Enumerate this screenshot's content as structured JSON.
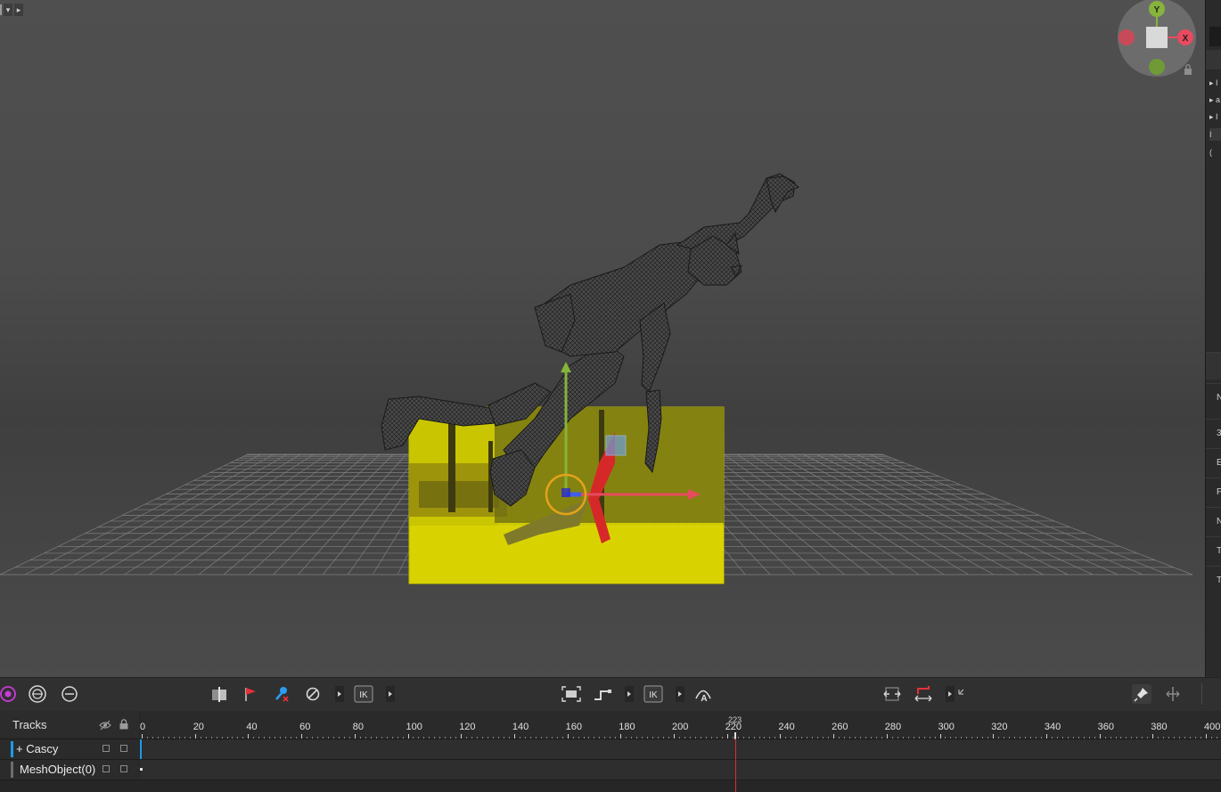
{
  "viewport": {
    "gizmo": {
      "axis_y": "Y",
      "axis_x": "X",
      "lock_icon": "lock-icon"
    },
    "colors": {
      "background_top": "#4f4f4f",
      "grid_line": "#8a8a8a",
      "video_plane_tint": "#d8d400",
      "axis_x": "#e84a5f",
      "axis_y": "#86b33c",
      "rotate_ring": "#e3a21a"
    }
  },
  "right_panel": {
    "partial_items": [
      "▸ I",
      "▸ a",
      "▸ I",
      "I",
      "("
    ],
    "partial_fields": [
      "N",
      "3",
      "E",
      "F",
      "N",
      "T",
      "T"
    ]
  },
  "toolbar": {
    "ik_label_1": "IK",
    "ik_label_2": "IK",
    "auto_label": "A",
    "icons": [
      "pose-target-icon",
      "orbit-icon",
      "rotate-view-icon",
      "split-keyframe-icon",
      "flag-marker-icon",
      "key-remove-icon",
      "disable-icon",
      "ik-toggle-icon",
      "frame-selection-icon",
      "step-curve-icon",
      "ik-mode-icon",
      "auto-key-icon",
      "fit-range-icon",
      "mirror-curve-icon",
      "pin-icon",
      "move-keys-icon"
    ]
  },
  "timeline": {
    "tracks_title": "Tracks",
    "tracks": [
      {
        "label": "+ Cascy",
        "accent": "#1e9be8"
      },
      {
        "label": "MeshObject(0)",
        "accent": "#6e6e6e"
      }
    ],
    "ruler_labels": [
      "0",
      "20",
      "40",
      "60",
      "80",
      "100",
      "120",
      "140",
      "160",
      "180",
      "200",
      "220",
      "240",
      "260",
      "280",
      "300",
      "320",
      "340",
      "360",
      "380",
      "400"
    ],
    "current_frame": "223",
    "playhead_color": "#d9312f"
  }
}
